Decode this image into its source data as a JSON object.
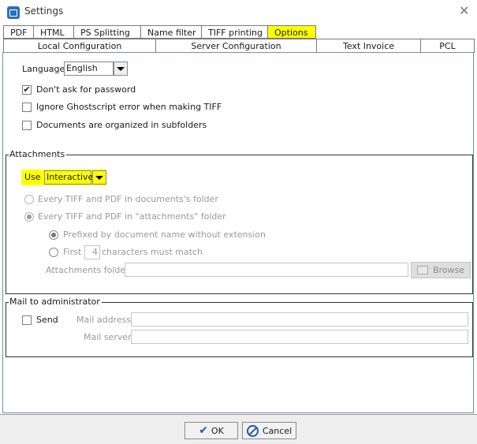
{
  "window": {
    "title": "Settings"
  },
  "tabs_row1": [
    "PDF",
    "HTML",
    "PS Splitting",
    "Name filter",
    "TIFF printing",
    "Options"
  ],
  "tabs_row2": [
    "Local Configuration",
    "Server Configuration",
    "Text Invoice",
    "PCL"
  ],
  "language": {
    "label": "Language",
    "value": "English"
  },
  "options": [
    {
      "label": "Don't ask for password",
      "checked": true
    },
    {
      "label": "Ignore Ghostscript error when making TIFF",
      "checked": false
    },
    {
      "label": "Documents are organized in subfolders",
      "checked": false
    }
  ],
  "attachments": {
    "legend": "Attachments",
    "use_label": "Use",
    "use_value": "Interactive",
    "radio_every_docs": "Every TIFF and PDF in documents's folder",
    "radio_every_attach": "Every TIFF and PDF in \"attachments\" folder",
    "radio_prefixed": "Prefixed by document name without extension",
    "radio_first": "First",
    "first_count": "4",
    "first_suffix": "characters must match",
    "folder_label": "Attachments folder",
    "folder_value": "",
    "browse_label": "Browse"
  },
  "mail": {
    "legend": "Mail to administrator",
    "send_label": "Send",
    "address_label": "Mail address",
    "server_label": "Mail server"
  },
  "buttons": {
    "ok": "OK",
    "cancel": "Cancel"
  },
  "colors": {
    "highlight": "#ffff00",
    "accent": "#2b6fb8"
  }
}
